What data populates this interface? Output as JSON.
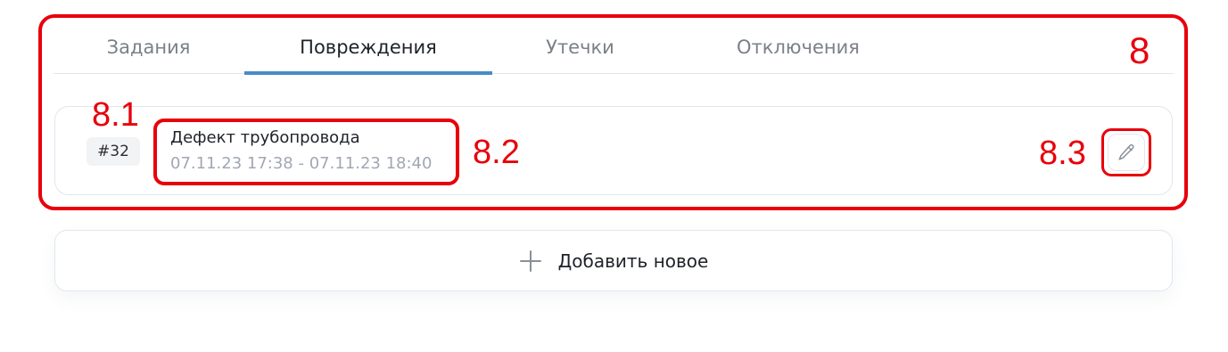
{
  "tabs": [
    {
      "label": "Задания",
      "active": false
    },
    {
      "label": "Повреждения",
      "active": true
    },
    {
      "label": "Утечки",
      "active": false
    },
    {
      "label": "Отключения",
      "active": false
    }
  ],
  "record": {
    "id": "#32",
    "title": "Дефект трубопровода",
    "dates": "07.11.23 17:38 - 07.11.23 18:40",
    "edit_icon": "pencil-icon"
  },
  "add_button": {
    "icon": "plus-icon",
    "label": "Добавить новое"
  },
  "annotations": {
    "area": "8",
    "id_badge": "8.1",
    "record_info": "8.2",
    "edit_button": "8.3"
  },
  "colors": {
    "accent": "#4a8cc4",
    "annotation": "#e8000b",
    "muted_text": "#a1a7b3",
    "tab_inactive": "#7b8088"
  }
}
